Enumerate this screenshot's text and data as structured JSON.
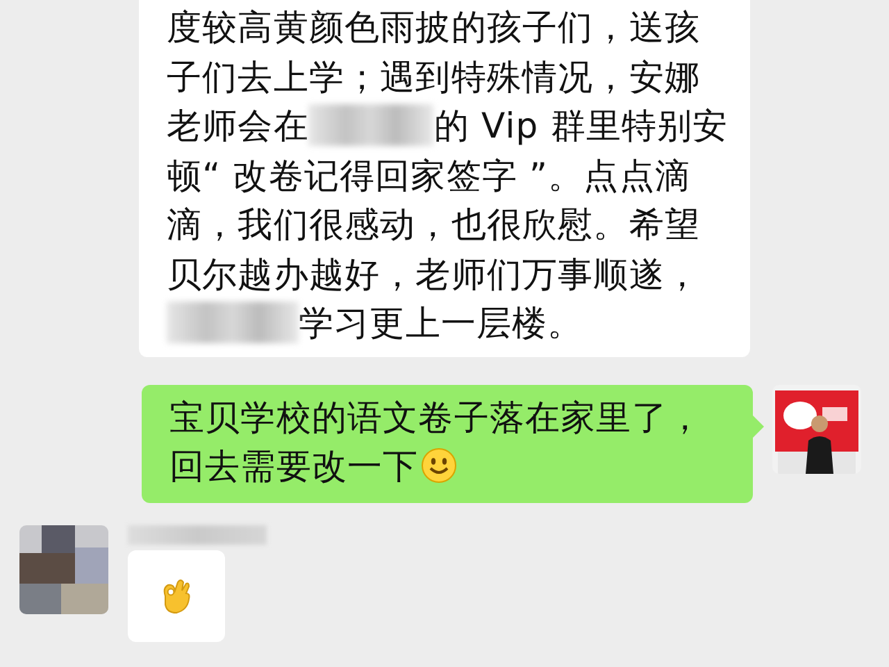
{
  "messages": [
    {
      "kind": "incoming",
      "lines": [
        [
          {
            "kind": "text",
            "text": "度较高黄颜色雨披的孩子们，送孩"
          }
        ],
        [
          {
            "kind": "text",
            "text": "子们去上学；遇到特殊情况，安娜"
          }
        ],
        [
          {
            "kind": "text",
            "text": "老师会在"
          },
          {
            "kind": "blur"
          },
          {
            "kind": "text",
            "text": "的 Vip 群里特别安"
          }
        ],
        [
          {
            "kind": "text",
            "text": "顿“ 改卷记得回家签字 ”。点点滴"
          }
        ],
        [
          {
            "kind": "text",
            "text": "滴，我们很感动，也很欣慰。希望"
          }
        ],
        [
          {
            "kind": "text",
            "text": "贝尔越办越好，老师们万事顺遂，"
          }
        ],
        [
          {
            "kind": "blur"
          },
          {
            "kind": "text",
            "text": "学习更上一层楼。"
          }
        ]
      ]
    },
    {
      "kind": "outgoing",
      "lines": [
        [
          {
            "kind": "text",
            "text": "宝贝学校的语文卷子落在家里了，"
          }
        ],
        [
          {
            "kind": "text",
            "text": "回去需要改一下"
          },
          {
            "kind": "smiley"
          }
        ]
      ]
    },
    {
      "kind": "incoming-avatar",
      "lines": [
        [
          {
            "kind": "okhand"
          }
        ]
      ]
    }
  ]
}
